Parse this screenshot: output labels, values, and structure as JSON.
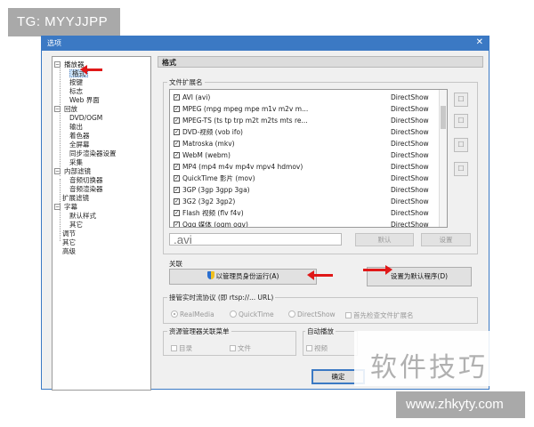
{
  "badge": {
    "text": "TG: MYYJJPP"
  },
  "dialog": {
    "title": "选项",
    "close_glyph": "✕"
  },
  "tree": {
    "items": [
      {
        "label": "播放器",
        "exp": "−"
      },
      {
        "label": "格式",
        "selected": true
      },
      {
        "label": "按键"
      },
      {
        "label": "标志"
      },
      {
        "label": "Web 界面"
      },
      {
        "label": "回放",
        "exp": "−"
      },
      {
        "label": "DVD/OGM"
      },
      {
        "label": "输出"
      },
      {
        "label": "着色器"
      },
      {
        "label": "全屏幕"
      },
      {
        "label": "同步渲染器设置"
      },
      {
        "label": "采集"
      },
      {
        "label": "内部滤镜",
        "exp": "−"
      },
      {
        "label": "音频切换器"
      },
      {
        "label": "音频渲染器"
      },
      {
        "label": "扩展滤镜"
      },
      {
        "label": "字幕",
        "exp": "−"
      },
      {
        "label": "默认样式"
      },
      {
        "label": "其它"
      },
      {
        "label": "调节"
      },
      {
        "label": "其它"
      },
      {
        "label": "高级"
      }
    ]
  },
  "panel": {
    "header": "格式",
    "ext_group_title": "文件扩展名",
    "extensions": [
      {
        "name": "AVI (avi)",
        "handler": "DirectShow"
      },
      {
        "name": "MPEG (mpg mpeg mpe m1v m2v m...",
        "handler": "DirectShow"
      },
      {
        "name": "MPEG-TS (ts tp trp m2t m2ts mts re...",
        "handler": "DirectShow"
      },
      {
        "name": "DVD-视频 (vob ifo)",
        "handler": "DirectShow"
      },
      {
        "name": "Matroska (mkv)",
        "handler": "DirectShow"
      },
      {
        "name": "WebM (webm)",
        "handler": "DirectShow"
      },
      {
        "name": "MP4 (mp4 m4v mp4v mpv4 hdmov)",
        "handler": "DirectShow"
      },
      {
        "name": "QuickTime 影片 (mov)",
        "handler": "DirectShow"
      },
      {
        "name": "3GP (3gp 3gpp 3ga)",
        "handler": "DirectShow"
      },
      {
        "name": "3G2 (3g2 3gp2)",
        "handler": "DirectShow"
      },
      {
        "name": "Flash 视频 (flv f4v)",
        "handler": "DirectShow"
      },
      {
        "name": "Ogg 媒体 (ogm ogv)",
        "handler": "DirectShow"
      }
    ],
    "ext_input_value": ".avi",
    "default_btn": "默认",
    "settings_btn": "设置",
    "assoc_group_title": "关联",
    "run_as_admin_btn": "以管理员身份运行(A)",
    "set_default_btn": "设置为默认程序(D)",
    "rtsp_group_title": "接管实时流协议 (即 rtsp://... URL)",
    "rtsp_options": [
      "RealMedia",
      "QuickTime",
      "DirectShow"
    ],
    "check_ext_label": "首先检查文件扩展名",
    "context_group_title": "资源管理器关联菜单",
    "context_dir_label": "目录",
    "context_file_label": "文件",
    "autoplay_group_title": "自动播放",
    "autoplay_video_label": "视频",
    "ok_btn": "确定"
  },
  "icons": {
    "side_buttons": [
      "☐",
      "☐",
      "☐",
      "☐"
    ]
  },
  "watermark": {
    "cn": "软件技巧",
    "url": "www.zhkyty.com"
  },
  "colors": {
    "titlebar": "#3b79c4",
    "arrow": "#e01818",
    "badge": "#a9a9a9"
  }
}
